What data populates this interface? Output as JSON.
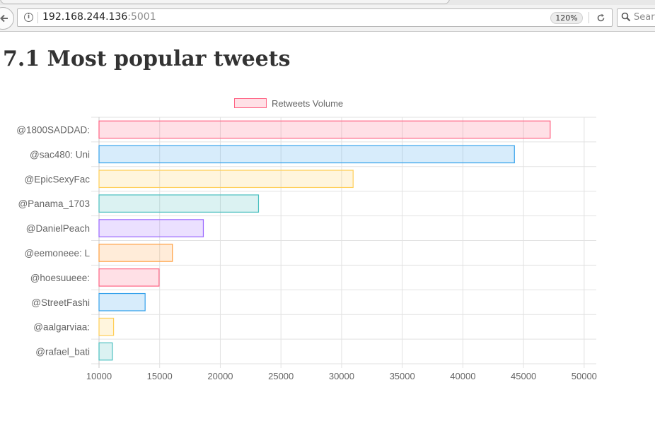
{
  "browser": {
    "url_host": "192.168.244.136",
    "url_port": ":5001",
    "zoom": "120%",
    "search_placeholder": "Search"
  },
  "page": {
    "title": "7.1 Most popular tweets"
  },
  "chart_data": {
    "type": "bar",
    "orientation": "horizontal",
    "categories": [
      "@1800SADDAD:",
      "@sac480: Uni",
      "@EpicSexyFac",
      "@Panama_1703",
      "@DanielPeach",
      "@eemoneee: L",
      "@hoesuueee:",
      "@StreetFashi",
      "@aalgarviaa:",
      "@rafael_bati"
    ],
    "series": [
      {
        "name": "Retweets Volume",
        "values": [
          47200,
          44250,
          30950,
          23150,
          18600,
          16050,
          14950,
          13800,
          11200,
          11100
        ]
      }
    ],
    "xlim": [
      10000,
      51000
    ],
    "x_ticks": [
      "10000",
      "15000",
      "20000",
      "25000",
      "30000",
      "35000",
      "40000",
      "45000",
      "50000"
    ],
    "grid": true,
    "legend_position": "top",
    "bar_colors": [
      "#ff6384",
      "#36a2eb",
      "#ffce56",
      "#4bc0c0",
      "#9966ff",
      "#ff9f40",
      "#ff6384",
      "#36a2eb",
      "#ffce56",
      "#4bc0c0"
    ]
  }
}
